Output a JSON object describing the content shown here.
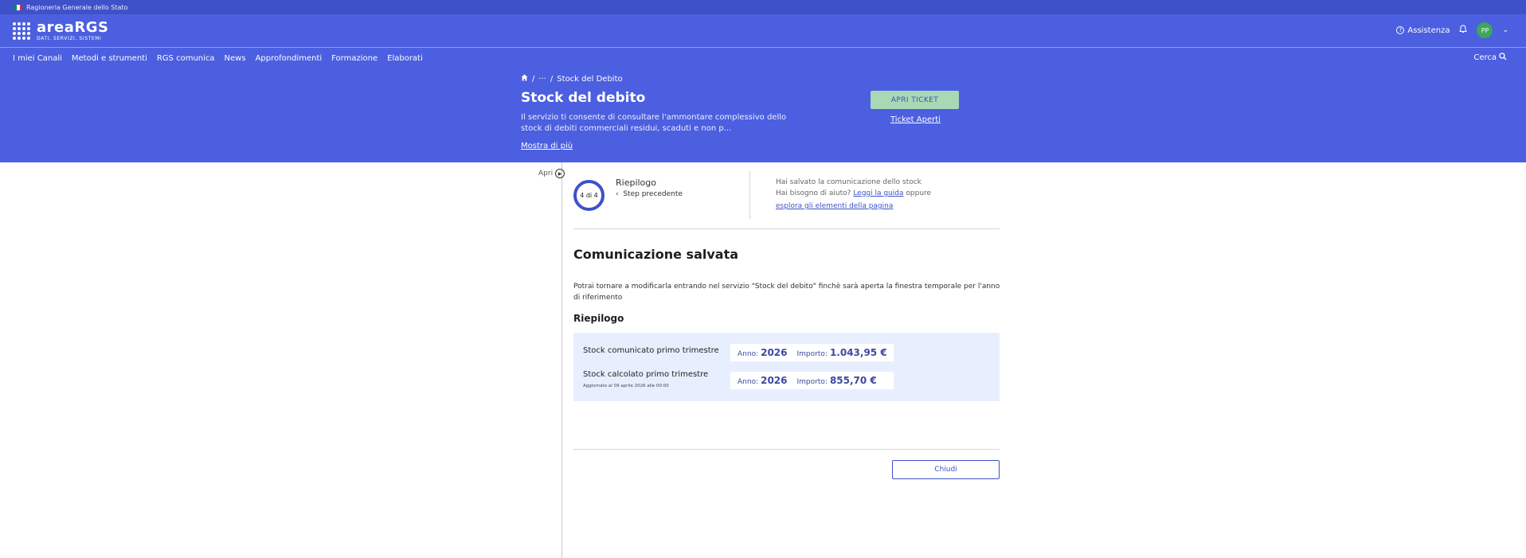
{
  "topbar": {
    "label": "Ragioneria Generale dello Stato"
  },
  "brand": {
    "name": "areaRGS",
    "subtitle": "DATI, SERVIZI, SISTEMI"
  },
  "header": {
    "help_label": "Assistenza",
    "avatar_initials": "PP"
  },
  "nav": {
    "items": [
      "I miei Canali",
      "Metodi e strumenti",
      "RGS comunica",
      "News",
      "Approfondimenti",
      "Formazione",
      "Elaborati"
    ],
    "search_label": "Cerca"
  },
  "hero": {
    "breadcrumb_ellipsis": "···",
    "breadcrumb_current": "Stock del Debito",
    "title": "Stock del debito",
    "description": "Il servizio ti consente di consultare l'ammontare complessivo dello stock di debiti commerciali residui, scaduti e non p...",
    "more_label": "Mostra di più",
    "ticket_button": "APRI TICKET",
    "ticket_link": "Ticket Aperti"
  },
  "sidebar": {
    "apri_label": "Apri"
  },
  "stepper": {
    "counter": "4 di 4",
    "title": "Riepilogo",
    "prev_label": "Step precedente",
    "info_saved": "Hai salvato la comunicazione dello stock",
    "info_help": "Hai bisogno di aiuto?",
    "info_guide_link": "Leggi la guida",
    "info_or": "oppure",
    "info_explore_link": "esplora gli elementi della pagina"
  },
  "content": {
    "heading": "Comunicazione salvata",
    "description": "Potrai tornare a modificarla entrando nel servizio \"Stock del debito\" finchè sarà aperta la finestra temporale per l'anno di riferimento",
    "summary_heading": "Riepilogo",
    "rows": [
      {
        "label": "Stock comunicato primo trimestre",
        "sub": "",
        "anno_label": "Anno:",
        "anno_value": "2026",
        "importo_label": "Importo:",
        "importo_value": "1.043,95 €"
      },
      {
        "label": "Stock calcolato primo trimestre",
        "sub": "Aggiornato al 09 aprile 2026 alle 00:00",
        "anno_label": "Anno:",
        "anno_value": "2026",
        "importo_label": "Importo:",
        "importo_value": "855,70 €"
      }
    ],
    "close_button": "Chiudi"
  },
  "colors": {
    "primary": "#4b5fe0",
    "ticket_button": "#a8d8b4",
    "panel": "#e7efff",
    "avatar": "#3ea55b"
  }
}
